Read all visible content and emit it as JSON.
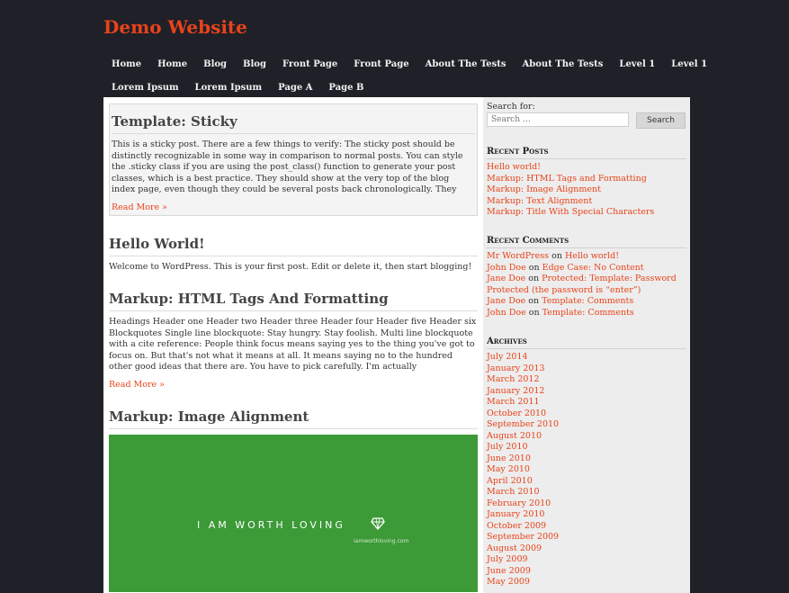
{
  "site": {
    "title": "Demo Website"
  },
  "nav": {
    "row1": [
      "Home",
      "Home",
      "Blog",
      "Blog",
      "Front Page",
      "Front Page",
      "About The Tests",
      "About The Tests",
      "Level 1",
      "Level 1"
    ],
    "row2": [
      "Lorem Ipsum",
      "Lorem Ipsum",
      "Page A",
      "Page B"
    ]
  },
  "posts": {
    "sticky": {
      "title": "Template: Sticky",
      "excerpt": "This is a sticky post. There are a few things to verify: The sticky post should be distinctly recognizable in some way in comparison to normal posts. You can style the .sticky class if you are using the post_class() function to generate your post classes, which is a best practice. They should show at the very top of the blog index page, even though they could be several posts back chronologically. They",
      "read_more": "Read More »"
    },
    "hello": {
      "title": "Hello World!",
      "excerpt": "Welcome to WordPress. This is your first post. Edit or delete it, then start blogging!"
    },
    "markup": {
      "title": "Markup: HTML Tags And Formatting",
      "excerpt": "Headings Header one Header two Header three Header four Header five Header six Blockquotes Single line blockquote: Stay hungry. Stay foolish. Multi line blockquote with a cite reference: People think focus means saying yes to the thing you've got to focus on. But that's not what it means at all. It means saying no to the hundred other good ideas that there are. You have to pick carefully. I'm actually",
      "read_more": "Read More »"
    },
    "image": {
      "title": "Markup: Image Alignment",
      "image_text": "I AM WORTH LOVING",
      "image_subtext": "iamworthloving.com",
      "image_color": "#3c9a37"
    }
  },
  "sidebar": {
    "search_label": "Search for:",
    "search_placeholder": "Search …",
    "search_button": "Search",
    "recent_posts_title": "Recent Posts",
    "recent_posts": [
      "Hello world!",
      "Markup: HTML Tags and Formatting",
      "Markup: Image Alignment",
      "Markup: Text Alignment",
      "Markup: Title With Special Characters"
    ],
    "recent_comments_title": "Recent Comments",
    "comments": [
      {
        "author": "Mr WordPress",
        "on": "on",
        "post": "Hello world!"
      },
      {
        "author": "John Doe",
        "on": "on",
        "post": "Edge Case: No Content"
      },
      {
        "author": "Jane Doe",
        "on": "on",
        "post": "Protected: Template: Password Protected (the password is “enter”)"
      },
      {
        "author": "Jane Doe",
        "on": "on",
        "post": "Template: Comments"
      },
      {
        "author": "John Doe",
        "on": "on",
        "post": "Template: Comments"
      }
    ],
    "archives_title": "Archives",
    "archives": [
      "July 2014",
      "January 2013",
      "March 2012",
      "January 2012",
      "March 2011",
      "October 2010",
      "September 2010",
      "August 2010",
      "July 2010",
      "June 2010",
      "May 2010",
      "April 2010",
      "March 2010",
      "February 2010",
      "January 2010",
      "October 2009",
      "September 2009",
      "August 2009",
      "July 2009",
      "June 2009",
      "May 2009"
    ]
  },
  "colors": {
    "accent": "#e8431a",
    "background": "#1f2028",
    "sidebar": "#ededed"
  }
}
